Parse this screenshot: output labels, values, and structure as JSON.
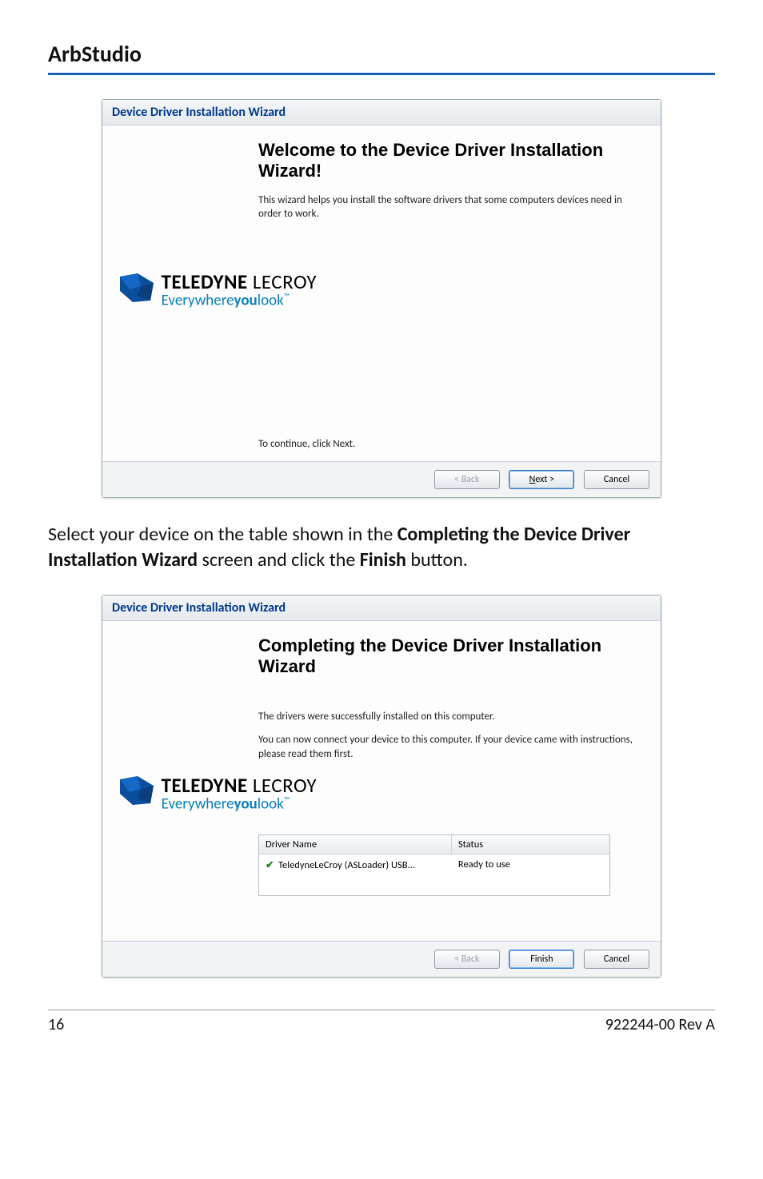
{
  "pageTitle": "ArbStudio",
  "wizard1": {
    "windowTitle": "Device Driver Installation Wizard",
    "heading": "Welcome to the Device Driver Installation Wizard!",
    "body": "This wizard helps you install the software drivers that some computers devices need in order to work.",
    "continue": "To continue, click Next.",
    "back": "< Back",
    "next": "Next >",
    "cancel": "Cancel"
  },
  "logo": {
    "line1a": "TELEDYNE",
    "line1b": " LECROY",
    "line2a": "Everywhere",
    "line2b": "you",
    "line2c": "look",
    "tm": "™"
  },
  "instruction": {
    "pre": "Select your device on the table shown in the ",
    "bold1": "Completing the Device Driver Installation Wizard",
    "mid": " screen and click the ",
    "bold2": "Finish",
    "post": " button."
  },
  "wizard2": {
    "windowTitle": "Device Driver Installation Wizard",
    "heading": "Completing the Device Driver Installation Wizard",
    "body1": "The drivers were successfully installed on this computer.",
    "body2": "You can now connect your device to this computer. If your device came with instructions, please read them first.",
    "colDriver": "Driver Name",
    "colStatus": "Status",
    "rowDriver": "TeledyneLeCroy (ASLoader) USB...",
    "rowStatus": "Ready to use",
    "back": "< Back",
    "finish": "Finish",
    "cancel": "Cancel"
  },
  "footer": {
    "page": "16",
    "doc": "922244-00 Rev A"
  }
}
